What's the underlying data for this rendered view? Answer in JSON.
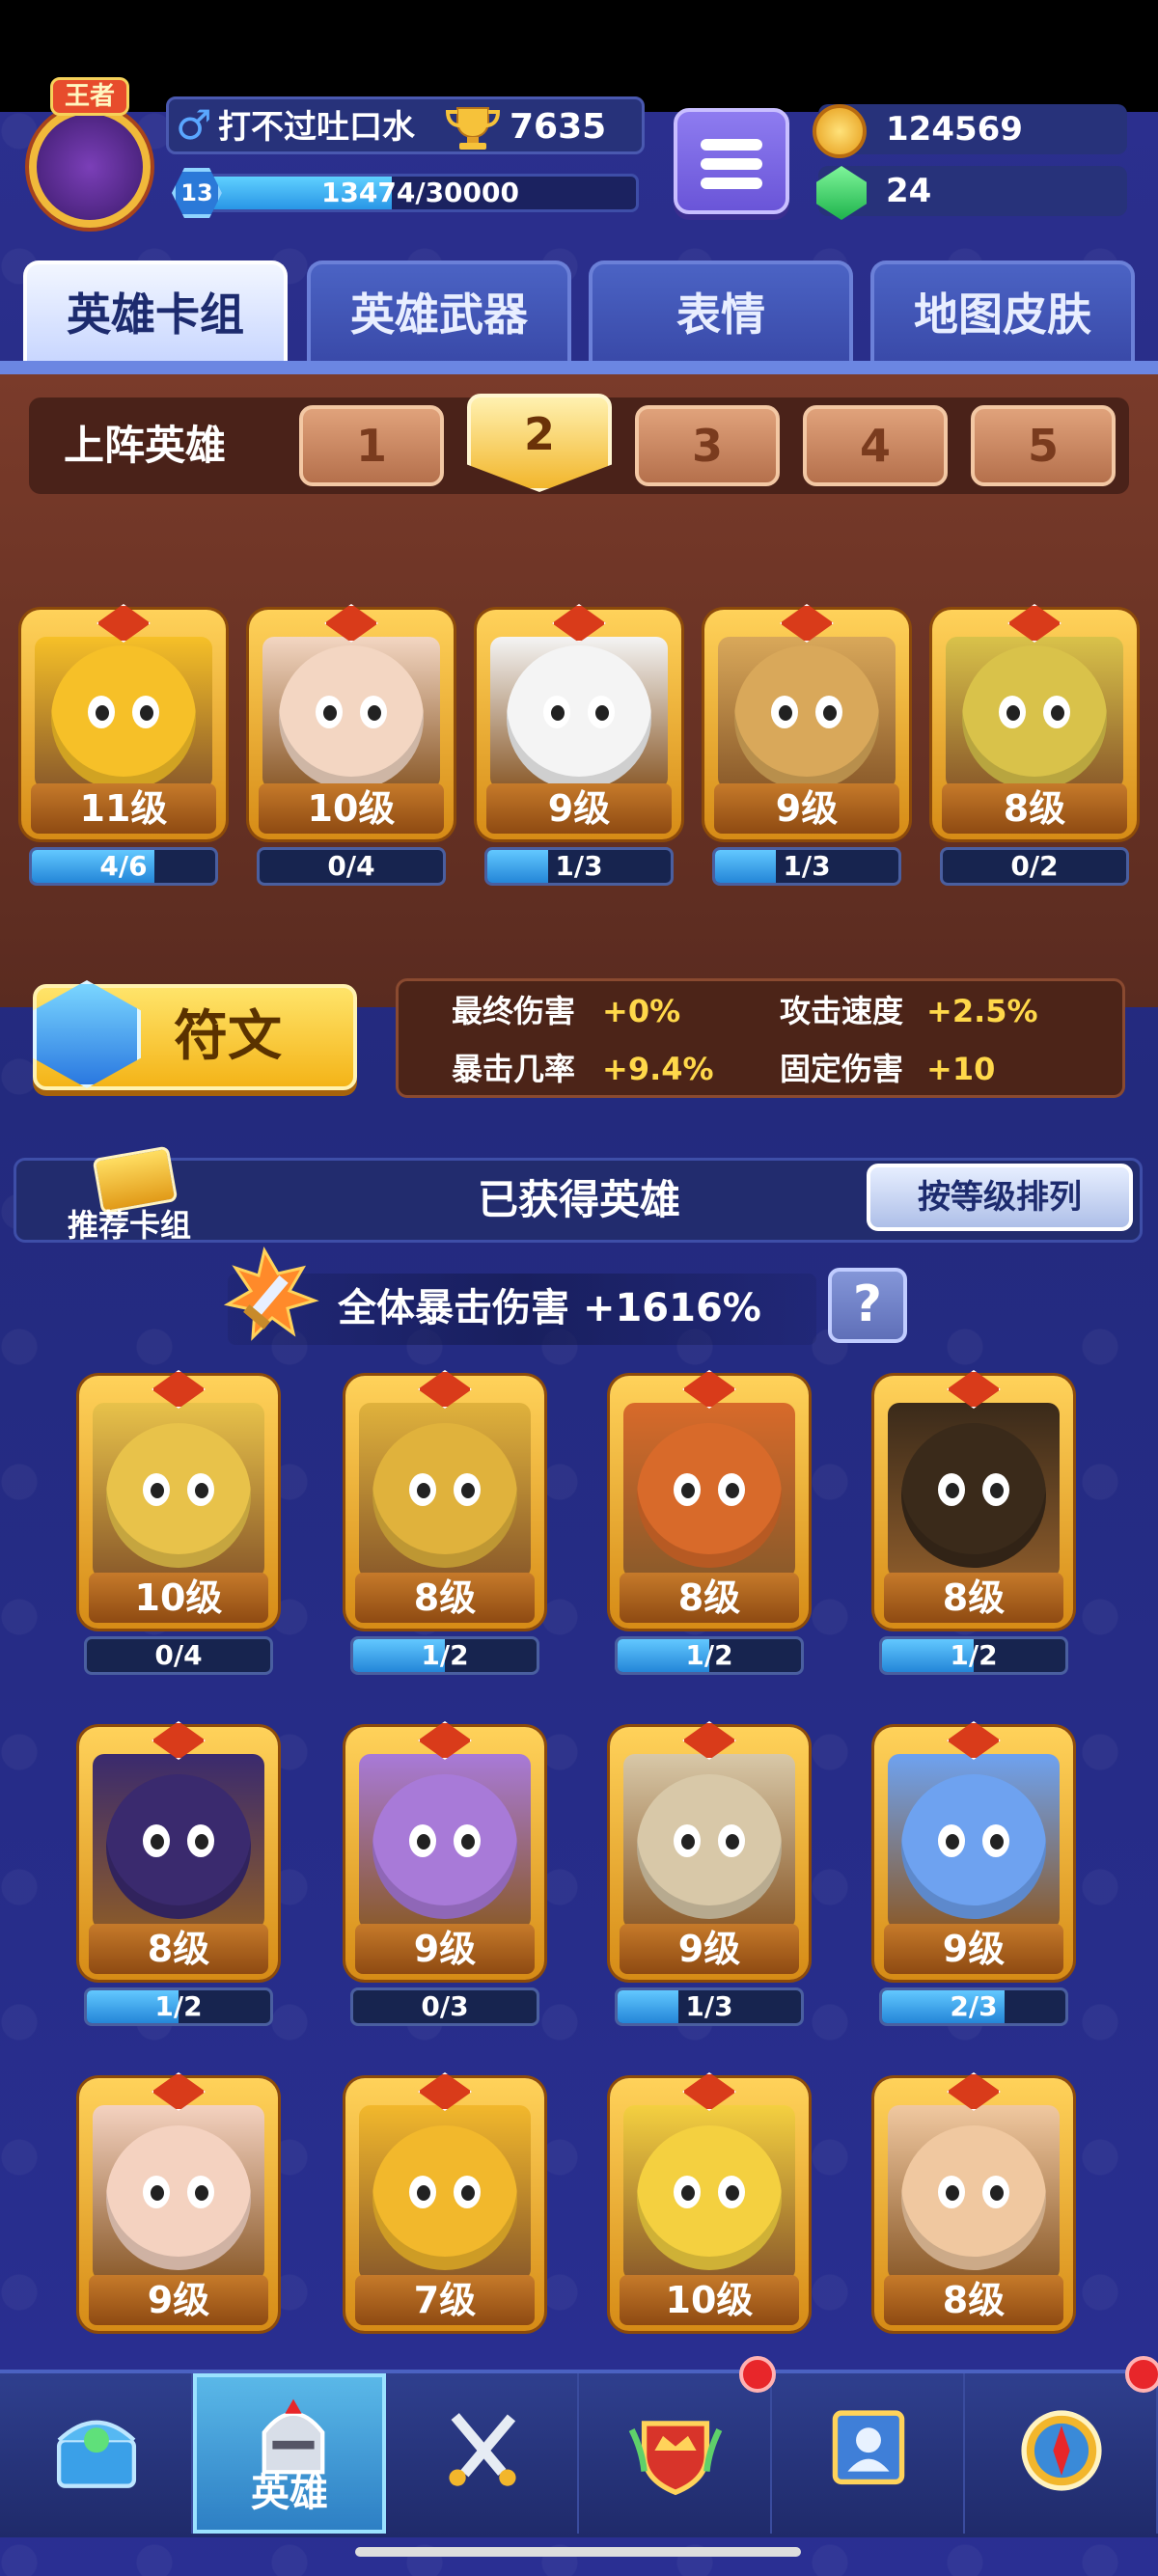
{
  "header": {
    "player_name": "打不过吐口水",
    "title_badge": "王者",
    "trophies": "7635",
    "level": "13",
    "xp_text": "13474/30000",
    "xp_fraction": 0.449,
    "coins": "124569",
    "gems": "24"
  },
  "tabs": [
    {
      "label": "英雄卡组",
      "active": true
    },
    {
      "label": "英雄武器",
      "active": false
    },
    {
      "label": "表情",
      "active": false
    },
    {
      "label": "地图皮肤",
      "active": false
    }
  ],
  "deck": {
    "title": "上阵英雄",
    "slots": [
      "1",
      "2",
      "3",
      "4",
      "5"
    ],
    "active_slot": "2",
    "heroes": [
      {
        "level": "11级",
        "progress": "4/6",
        "fraction": 0.67,
        "color": "#f6c028"
      },
      {
        "level": "10级",
        "progress": "0/4",
        "fraction": 0,
        "color": "#f3d6c2"
      },
      {
        "level": "9级",
        "progress": "1/3",
        "fraction": 0.33,
        "color": "#f4f4f4"
      },
      {
        "level": "9级",
        "progress": "1/3",
        "fraction": 0.33,
        "color": "#d9a85a"
      },
      {
        "level": "8级",
        "progress": "0/2",
        "fraction": 0,
        "color": "#d9c24a"
      }
    ]
  },
  "runes": {
    "label": "符文",
    "stats": [
      {
        "key": "最终伤害",
        "value": "+0%"
      },
      {
        "key": "攻击速度",
        "value": "+2.5%"
      },
      {
        "key": "暴击几率",
        "value": "+9.4%"
      },
      {
        "key": "固定伤害",
        "value": "+10"
      }
    ]
  },
  "owned": {
    "recommend_label": "推荐卡组",
    "title": "已获得英雄",
    "sort_label": "按等级排列",
    "crit_label": "全体暴击伤害",
    "crit_value": "+1616%",
    "help_label": "?",
    "heroes": [
      {
        "level": "10级",
        "progress": "0/4",
        "fraction": 0,
        "color": "#e8c24a"
      },
      {
        "level": "8级",
        "progress": "1/2",
        "fraction": 0.5,
        "color": "#e0b23c"
      },
      {
        "level": "8级",
        "progress": "1/2",
        "fraction": 0.5,
        "color": "#d86a2a"
      },
      {
        "level": "8级",
        "progress": "1/2",
        "fraction": 0.5,
        "color": "#3a2a1a"
      },
      {
        "level": "8级",
        "progress": "1/2",
        "fraction": 0.5,
        "color": "#3a2a6e"
      },
      {
        "level": "9级",
        "progress": "0/3",
        "fraction": 0,
        "color": "#a87ad8"
      },
      {
        "level": "9级",
        "progress": "1/3",
        "fraction": 0.33,
        "color": "#d8c8a8"
      },
      {
        "level": "9级",
        "progress": "2/3",
        "fraction": 0.67,
        "color": "#6ea2f0"
      },
      {
        "level": "9级",
        "progress": "",
        "fraction": 0,
        "color": "#f4d2c0"
      },
      {
        "level": "7级",
        "progress": "",
        "fraction": 0,
        "color": "#f2b82c"
      },
      {
        "level": "10级",
        "progress": "",
        "fraction": 0,
        "color": "#f4d040"
      },
      {
        "level": "8级",
        "progress": "",
        "fraction": 0,
        "color": "#f0c8a0"
      }
    ]
  },
  "nav": [
    {
      "label": "",
      "icon": "treasure-chest-icon",
      "active": false,
      "dot": false
    },
    {
      "label": "英雄",
      "icon": "knight-helmet-icon",
      "active": true,
      "dot": false
    },
    {
      "label": "",
      "icon": "crossed-swords-icon",
      "active": false,
      "dot": false
    },
    {
      "label": "",
      "icon": "crown-shield-icon",
      "active": false,
      "dot": true
    },
    {
      "label": "",
      "icon": "team-board-icon",
      "active": false,
      "dot": false
    },
    {
      "label": "",
      "icon": "compass-icon",
      "active": false,
      "dot": true
    }
  ]
}
